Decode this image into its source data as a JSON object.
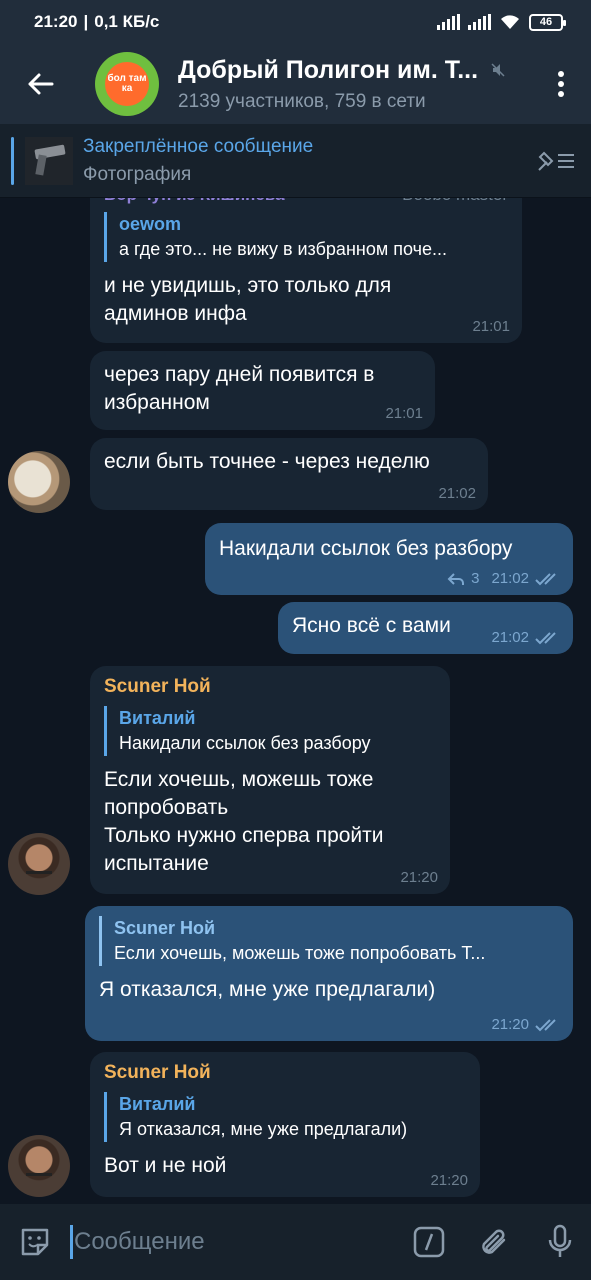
{
  "status": {
    "time": "21:20",
    "speed": "0,1 КБ/с",
    "battery": "46"
  },
  "header": {
    "title": "Добрый Полигон им. Т...",
    "subtitle": "2139 участников, 759 в сети",
    "avatar_text": "бол там ка"
  },
  "pinned": {
    "title": "Закреплённое сообщение",
    "subtitle": "Фотография"
  },
  "messages": [
    {
      "top_cut_text": "Вор  чун из Кишинева",
      "top_cut_right": "Boobo master",
      "quote_name": "oewom",
      "quote_text": "а где это... не вижу в избранном поче...",
      "text": "и не увидишь, это только для\nадминов инфа",
      "time": "21:01"
    },
    {
      "text": "через пару дней появится в\nизбранном",
      "time": "21:01"
    },
    {
      "text": "если быть точнее - через неделю",
      "time": "21:02"
    },
    {
      "text": "Накидали ссылок без разбору",
      "replies": "3",
      "time": "21:02"
    },
    {
      "text": "Ясно всё с вами",
      "time": "21:02"
    },
    {
      "sender": "Scuner Ной",
      "quote_name": "Виталий",
      "quote_text": "Накидали ссылок без разбору",
      "text": "Если хочешь, можешь тоже\nпопробовать\nТолько нужно сперва пройти\nиспытание",
      "time": "21:20"
    },
    {
      "quote_name": "Scuner Ной",
      "quote_text": "Если хочешь, можешь тоже попробовать Т...",
      "text": "Я отказался, мне уже предлагали)",
      "time": "21:20"
    },
    {
      "sender": "Scuner Ной",
      "quote_name": "Виталий",
      "quote_text": "Я отказался, мне уже предлагали)",
      "text": "Вот и не ной",
      "time": "21:20"
    }
  ],
  "input": {
    "placeholder": "Сообщение"
  },
  "colors": {
    "background": "#0e1621",
    "incoming": "#182533",
    "outgoing": "#2b5278",
    "accent": "#5aa6e8",
    "sender_name": "#f2b35b"
  },
  "icons": {
    "back": "arrow-left-icon",
    "more": "more-vertical-icon",
    "mute": "muted-icon",
    "pin_list": "pin-list-icon",
    "emoji": "sticker-icon",
    "command": "slash-command-icon",
    "attach": "paperclip-icon",
    "mic": "microphone-icon",
    "read": "double-check-icon",
    "reply": "reply-arrow-icon"
  }
}
